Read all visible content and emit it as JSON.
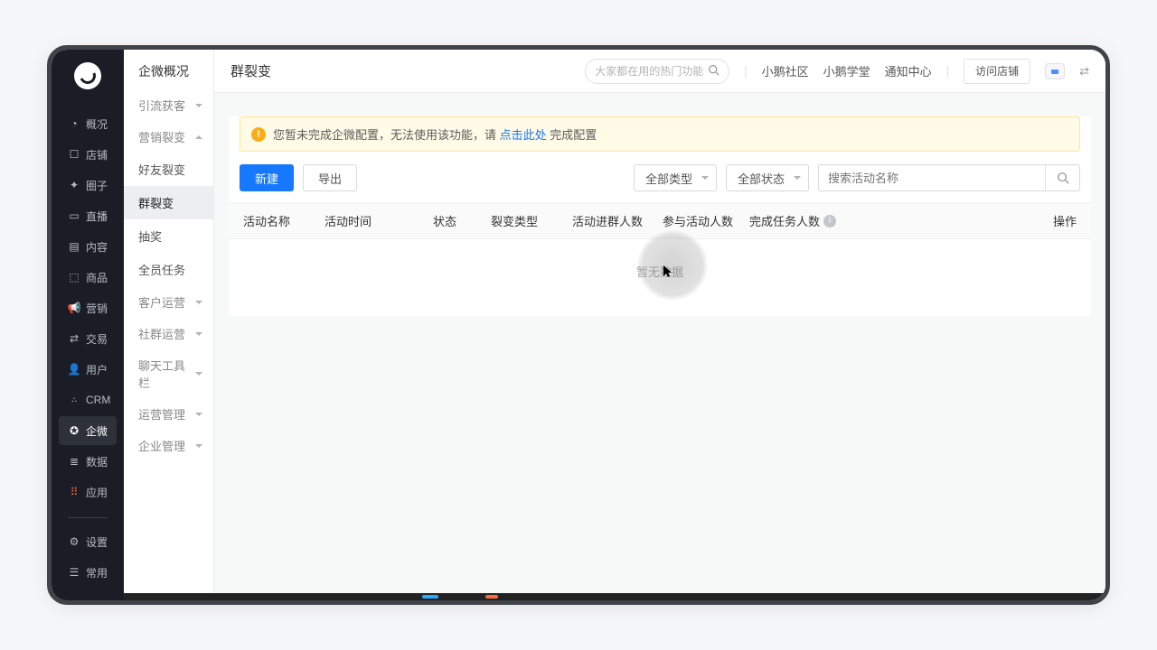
{
  "sidebar_primary": {
    "items": [
      {
        "icon": "◔",
        "label": "概况"
      },
      {
        "icon": "☐",
        "label": "店铺"
      },
      {
        "icon": "✦",
        "label": "圈子"
      },
      {
        "icon": "▭",
        "label": "直播"
      },
      {
        "icon": "▤",
        "label": "内容"
      },
      {
        "icon": "⬚",
        "label": "商品"
      },
      {
        "icon": "📢",
        "label": "营销"
      },
      {
        "icon": "⇄",
        "label": "交易"
      },
      {
        "icon": "👤",
        "label": "用户"
      },
      {
        "icon": "CRM",
        "label": "CRM"
      },
      {
        "icon": "✪",
        "label": "企微",
        "active": true
      },
      {
        "icon": "≣",
        "label": "数据"
      },
      {
        "icon": "⠿",
        "label": "应用"
      }
    ],
    "bottom": [
      {
        "icon": "⚙",
        "label": "设置"
      },
      {
        "icon": "☰",
        "label": "常用"
      }
    ]
  },
  "sidebar_secondary": {
    "title": "企微概况",
    "groups": [
      {
        "label": "引流获客",
        "open": false,
        "items": []
      },
      {
        "label": "营销裂变",
        "open": true,
        "items": [
          {
            "label": "好友裂变"
          },
          {
            "label": "群裂变",
            "selected": true
          },
          {
            "label": "抽奖"
          },
          {
            "label": "全员任务"
          }
        ]
      },
      {
        "label": "客户运营",
        "open": false,
        "items": []
      },
      {
        "label": "社群运营",
        "open": false,
        "items": []
      },
      {
        "label": "聊天工具栏",
        "open": false,
        "items": []
      },
      {
        "label": "运营管理",
        "open": false,
        "items": []
      },
      {
        "label": "企业管理",
        "open": false,
        "items": []
      }
    ]
  },
  "header": {
    "title": "群裂变",
    "search_placeholder": "大家都在用的热门功能",
    "links": [
      "小鹅社区",
      "小鹅学堂",
      "通知中心"
    ],
    "visit_shop": "访问店铺"
  },
  "alert": {
    "text_before": "您暂未完成企微配置，无法使用该功能，请 ",
    "link": "点击此处",
    "text_after": " 完成配置"
  },
  "toolbar": {
    "new_label": "新建",
    "export_label": "导出",
    "select_type": "全部类型",
    "select_status": "全部状态",
    "search_placeholder": "搜索活动名称"
  },
  "table": {
    "columns": [
      "活动名称",
      "活动时间",
      "状态",
      "裂变类型",
      "活动进群人数",
      "参与活动人数",
      "完成任务人数",
      "操作"
    ],
    "empty": "暂无数据"
  }
}
